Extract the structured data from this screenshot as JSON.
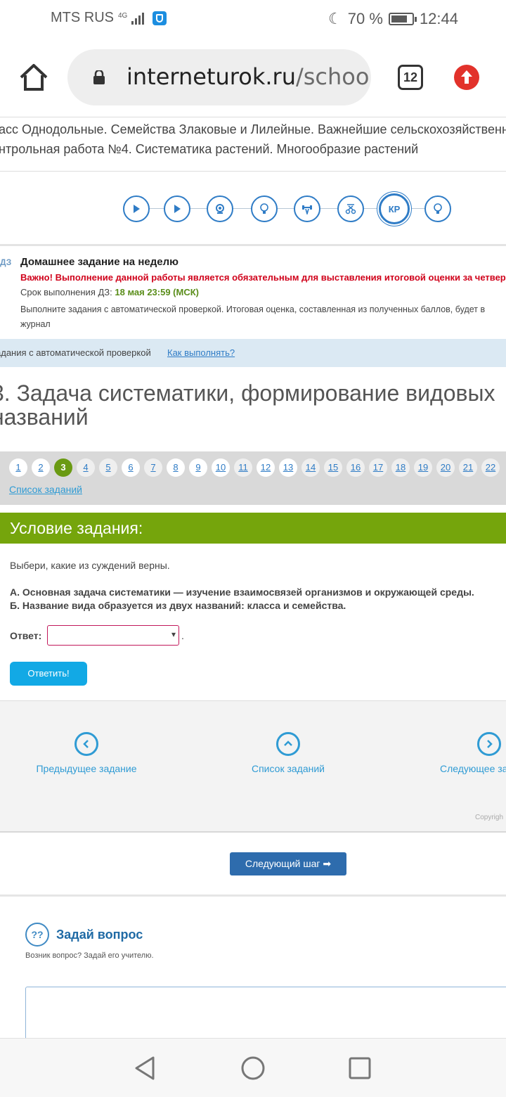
{
  "status_bar": {
    "carrier": "MTS RUS",
    "network": "4G",
    "battery": "70 %",
    "time": "12:44"
  },
  "browser": {
    "url_host": "interneturok.ru",
    "url_path": "/school/",
    "tab_count": "12"
  },
  "breadcrumbs": [
    "асс Однодольные. Семейства Злаковые и Лилейные. Важнейшие сельскохозяйственн",
    "нтрольная работа №4. Систематика растений. Многообразие растений"
  ],
  "steps": [
    "play",
    "play",
    "webcam",
    "lightbulb",
    "trainer",
    "test",
    "КР",
    "lightbulb"
  ],
  "homework": {
    "tag": "ДЗ",
    "title": "Домашнее задание на неделю",
    "important": "Важно! Выполнение данной работы является обязательным для выставления итоговой оценки за четверть.",
    "deadline_label": "Срок выполнения ДЗ:",
    "deadline_value": "18 мая 23:59 (МСК)",
    "note": "Выполните задания с автоматической проверкой. Итоговая оценка, составленная из полученных баллов, будет в журнал"
  },
  "autocheck": {
    "text": "адания с автоматической проверкой",
    "link": "Как выполнять?"
  },
  "task_title_line1": "3. Задача систематики, формирование видовых",
  "task_title_line2": "названий",
  "pager": {
    "pages": [
      "1",
      "2",
      "3",
      "4",
      "5",
      "6",
      "7",
      "8",
      "9",
      "10",
      "11",
      "12",
      "13",
      "14",
      "15",
      "16",
      "17",
      "18",
      "19",
      "20",
      "21",
      "22"
    ],
    "active": "3",
    "list_link": "Список заданий"
  },
  "condition": {
    "header": "Условие задания:",
    "intro": "Выбери, какие из суждений верны.",
    "statement_a": "А. Основная задача систематики — изучение взаимосвязей организмов и окружающей среды.",
    "statement_b": "Б. Название вида образуется из двух названий: класса и семейства.",
    "answer_label": "Ответ:",
    "answer_value": "",
    "answer_dot": ".",
    "submit": "Ответить!"
  },
  "nav": {
    "prev": "Предыдущее задание",
    "list": "Список заданий",
    "next": "Следующее за",
    "copyright": "Copyrigh"
  },
  "next_step": "Следующий шаг ➡",
  "ask": {
    "icon_text": "?",
    "title": "Задай вопрос",
    "subtitle": "Возник вопрос? Задай его учителю.",
    "input_value": ""
  },
  "colors": {
    "green_header": "#75a50c",
    "active_page": "#6a9a12",
    "submit_blue": "#12a9e5",
    "next_step_blue": "#2e6cad",
    "important_red": "#d0021b"
  }
}
